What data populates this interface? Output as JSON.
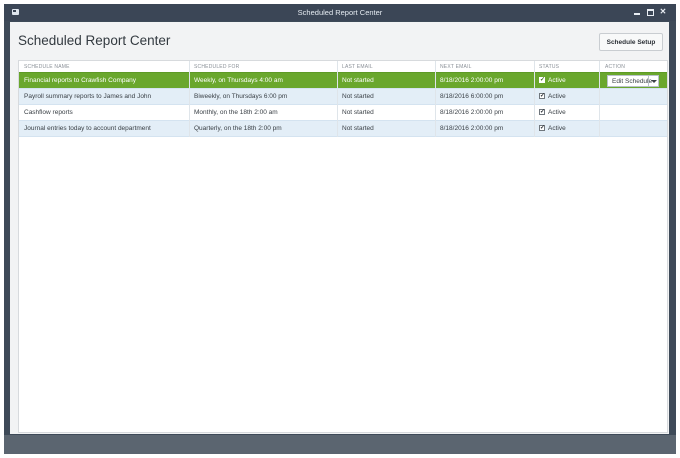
{
  "window": {
    "title": "Scheduled Report Center"
  },
  "page": {
    "title": "Scheduled Report Center"
  },
  "toolbar": {
    "setup_label": "Schedule Setup"
  },
  "table": {
    "headers": [
      "SCHEDULE NAME",
      "SCHEDULED FOR",
      "LAST EMAIL",
      "NEXT EMAIL",
      "STATUS",
      "ACTION"
    ],
    "rows": [
      {
        "name": "Financial reports to Crawfish Company",
        "scheduled": "Weekly, on Thursdays 4:00 am",
        "last": "Not started",
        "next": "8/18/2016 2:00:00 pm",
        "status": "Active",
        "checked": true,
        "action": "Edit Schedule"
      },
      {
        "name": "Payroll summary reports to James and John",
        "scheduled": "Biweekly, on Thursdays 6:00 pm",
        "last": "Not started",
        "next": "8/18/2016 6:00:00 pm",
        "status": "Active",
        "checked": true
      },
      {
        "name": "Cashflow reports",
        "scheduled": "Monthly, on the 18th 2:00 am",
        "last": "Not started",
        "next": "8/18/2016 2:00:00 pm",
        "status": "Active",
        "checked": true
      },
      {
        "name": "Journal entries today to account department",
        "scheduled": "Quarterly, on the 18th 2:00 pm",
        "last": "Not started",
        "next": "8/18/2016 2:00:00 pm",
        "status": "Active",
        "checked": true
      }
    ]
  },
  "colors": {
    "selected_row": "#6aa72d",
    "alt_row": "#e3eef7",
    "titlebar": "#3b4656"
  }
}
